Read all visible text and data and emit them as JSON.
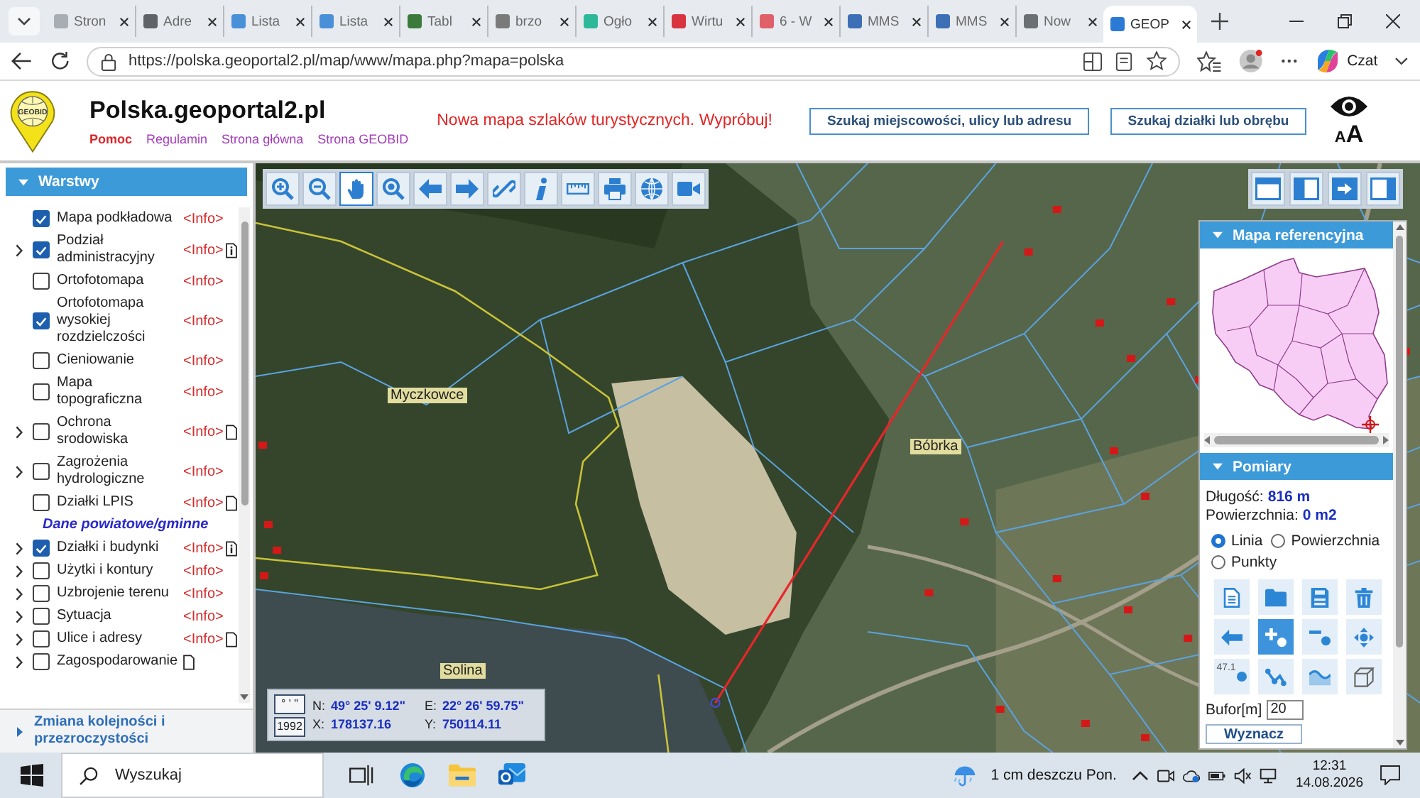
{
  "browser": {
    "tabs": [
      {
        "title": "Stron",
        "color": "#a8adb3",
        "selected": false
      },
      {
        "title": "Adre",
        "color": "#5f6368",
        "selected": false
      },
      {
        "title": "Lista",
        "color": "#4a90d9",
        "selected": false
      },
      {
        "title": "Lista",
        "color": "#4a90d9",
        "selected": false
      },
      {
        "title": "Tabl",
        "color": "#3c7a3c",
        "selected": false
      },
      {
        "title": "brzo",
        "color": "#7a7a7a",
        "selected": false
      },
      {
        "title": "Ogło",
        "color": "#2eb89a",
        "selected": false
      },
      {
        "title": "Wirtu",
        "color": "#d9333f",
        "selected": false
      },
      {
        "title": "6 - W",
        "color": "#e0606a",
        "selected": false
      },
      {
        "title": "MMS",
        "color": "#3d6fb6",
        "selected": false
      },
      {
        "title": "MMS",
        "color": "#3d6fb6",
        "selected": false
      },
      {
        "title": "Now",
        "color": "#6b7075",
        "selected": false
      },
      {
        "title": "GEOP",
        "color": "#2b7bd6",
        "selected": true
      }
    ],
    "url": "https://polska.geoportal2.pl/map/www/mapa.php?mapa=polska",
    "chat_button": "Czat"
  },
  "header": {
    "logo_text": "GEOBID",
    "title": "Polska.geoportal2.pl",
    "links": [
      {
        "label": "Pomoc",
        "color": "#d6262c"
      },
      {
        "label": "Regulamin",
        "color": "#a23bb8"
      },
      {
        "label": "Strona główna",
        "color": "#a23bb8"
      },
      {
        "label": "Strona GEOBID",
        "color": "#a23bb8"
      }
    ],
    "promo": "Nowa mapa szlaków turystycznych. Wypróbuj!",
    "search_buttons": [
      "Szukaj miejscowości, ulicy lub adresu",
      "Szukaj działki lub obrębu"
    ],
    "text_size": [
      "A",
      "A"
    ]
  },
  "map_tools": [
    {
      "kind": "zoomin",
      "selected": false
    },
    {
      "kind": "zoomout",
      "selected": false
    },
    {
      "kind": "pan",
      "selected": true
    },
    {
      "kind": "zoombox",
      "selected": false
    },
    {
      "kind": "back",
      "selected": false
    },
    {
      "kind": "forward",
      "selected": false
    },
    {
      "kind": "link",
      "selected": false
    },
    {
      "kind": "info",
      "selected": false
    },
    {
      "kind": "ruler",
      "selected": false
    },
    {
      "kind": "print",
      "selected": false
    },
    {
      "kind": "globe",
      "selected": false
    },
    {
      "kind": "camera",
      "selected": false
    }
  ],
  "layout_buttons": [
    {
      "kind": "full"
    },
    {
      "kind": "left"
    },
    {
      "kind": "arrow"
    },
    {
      "kind": "right"
    }
  ],
  "layers": {
    "title": "Warstwy",
    "items": [
      {
        "kind": "layer",
        "label": "Mapa podkładowa",
        "checked": true,
        "expandable": false,
        "info": "<Info>",
        "legend": false,
        "document": false
      },
      {
        "kind": "layer",
        "label": "Podział administracyjny",
        "checked": true,
        "expandable": true,
        "info": "<Info>",
        "legend": true,
        "document": false
      },
      {
        "kind": "layer",
        "label": "Ortofotomapa",
        "checked": false,
        "expandable": false,
        "info": "<Info>",
        "legend": false,
        "document": false
      },
      {
        "kind": "layer",
        "label": "Ortofotomapa wysokiej rozdzielczości",
        "checked": true,
        "expandable": false,
        "info": "<Info>",
        "legend": false,
        "document": false
      },
      {
        "kind": "layer",
        "label": "Cieniowanie",
        "checked": false,
        "expandable": false,
        "info": "<Info>",
        "legend": false,
        "document": false
      },
      {
        "kind": "layer",
        "label": "Mapa topograficzna",
        "checked": false,
        "expandable": false,
        "info": "<Info>",
        "legend": false,
        "document": false
      },
      {
        "kind": "layer",
        "label": "Ochrona srodowiska",
        "checked": false,
        "expandable": true,
        "info": "<Info>",
        "legend": false,
        "document": true
      },
      {
        "kind": "layer",
        "label": "Zagrożenia hydrologiczne",
        "checked": false,
        "expandable": true,
        "info": "<Info>",
        "legend": false,
        "document": false
      },
      {
        "kind": "layer",
        "label": "Działki LPIS",
        "checked": false,
        "expandable": false,
        "info": "<Info>",
        "legend": false,
        "document": true
      },
      {
        "kind": "section",
        "label": "Dane powiatowe/gminne"
      },
      {
        "kind": "layer",
        "label": "Działki i budynki",
        "checked": true,
        "expandable": true,
        "info": "<Info>",
        "legend": true,
        "document": false
      },
      {
        "kind": "layer",
        "label": "Użytki i kontury",
        "checked": false,
        "expandable": true,
        "info": "<Info>",
        "legend": false,
        "document": false
      },
      {
        "kind": "layer",
        "label": "Uzbrojenie terenu",
        "checked": false,
        "expandable": true,
        "info": "<Info>",
        "legend": false,
        "document": false
      },
      {
        "kind": "layer",
        "label": "Sytuacja",
        "checked": false,
        "expandable": true,
        "info": "<Info>",
        "legend": false,
        "document": false
      },
      {
        "kind": "layer",
        "label": "Ulice i adresy",
        "checked": false,
        "expandable": true,
        "info": "<Info>",
        "legend": false,
        "document": true
      },
      {
        "kind": "layer",
        "label": "Zagospodarowanie",
        "checked": false,
        "expandable": true,
        "legend": false,
        "document": true
      }
    ],
    "footer": "Zmiana kolejności i przezroczystości"
  },
  "map_labels": [
    {
      "text": "Myczkowce"
    },
    {
      "text": "Bóbrka"
    },
    {
      "text": "Solina"
    }
  ],
  "coordinates": {
    "format_buttons": [
      "° ' \"",
      "1992"
    ],
    "rows": [
      [
        {
          "label": "N:",
          "value": "49° 25' 9.12\""
        },
        {
          "label": "E:",
          "value": "22° 26' 59.75\""
        }
      ],
      [
        {
          "label": "X:",
          "value": "178137.16"
        },
        {
          "label": "Y:",
          "value": "750114.11"
        }
      ]
    ]
  },
  "reference_map": {
    "title": "Mapa referencyjna"
  },
  "measure": {
    "title": "Pomiary",
    "results": [
      {
        "label": "Długość:",
        "value": "816 m"
      },
      {
        "label": "Powierzchnia:",
        "value": "0 m2"
      }
    ],
    "modes": [
      {
        "label": "Linia",
        "selected": true
      },
      {
        "label": "Powierzchnia",
        "selected": false
      },
      {
        "label": "Punkty",
        "selected": false
      }
    ],
    "tools": [
      {
        "kind": "new",
        "selected": false
      },
      {
        "kind": "open",
        "selected": false
      },
      {
        "kind": "save",
        "selected": false
      },
      {
        "kind": "delete",
        "selected": false
      },
      {
        "kind": "undo",
        "selected": false
      },
      {
        "kind": "addpoint",
        "selected": true
      },
      {
        "kind": "removepoint",
        "selected": false
      },
      {
        "kind": "movepoint",
        "selected": false
      },
      {
        "kind": "label",
        "text": "47.1",
        "selected": false
      },
      {
        "kind": "polyline",
        "selected": false
      },
      {
        "kind": "curve",
        "selected": false
      },
      {
        "kind": "solid",
        "selected": false
      }
    ],
    "buffer": {
      "label": "Bufor[m]",
      "value": "20"
    },
    "submit": "Wyznacz"
  },
  "taskbar": {
    "search_placeholder": "Wyszukaj",
    "weather": "1 cm deszczu Pon.",
    "time": "12:31",
    "date": "14.08.2026"
  }
}
